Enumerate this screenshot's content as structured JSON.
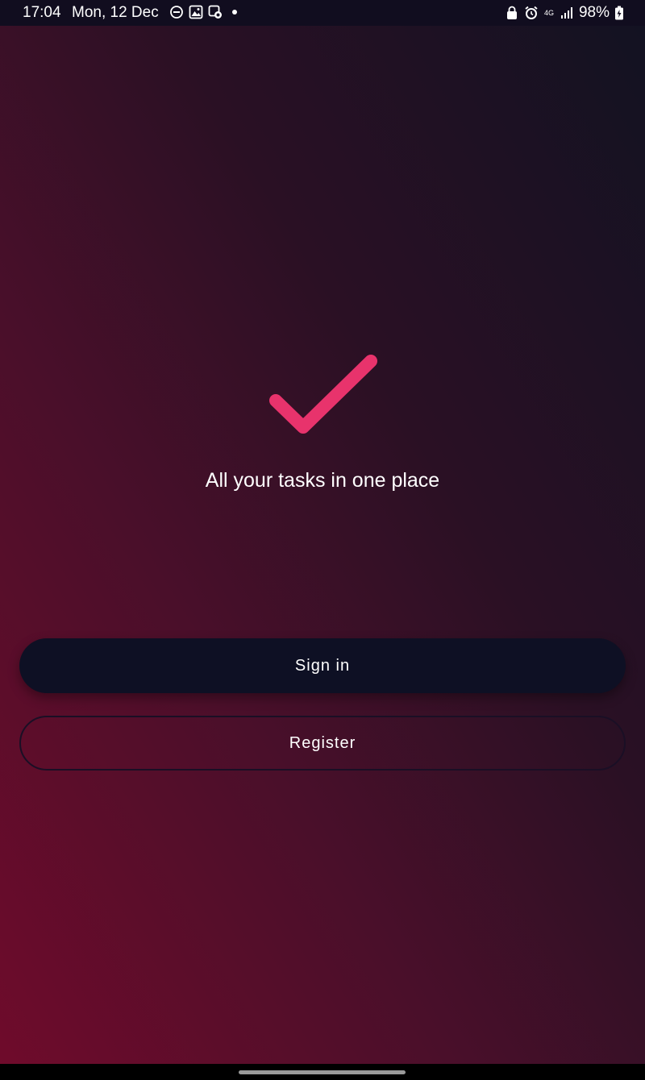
{
  "status_bar": {
    "time": "17:04",
    "date": "Mon, 12 Dec",
    "left_icons": [
      "do-not-disturb-icon",
      "gallery-icon",
      "screen-recorder-icon",
      "notification-dot-icon"
    ],
    "network": "4G",
    "battery": "98%"
  },
  "main": {
    "logo_icon": "checkmark-icon",
    "accent_color": "#e8336c",
    "tagline": "All your tasks in one place"
  },
  "actions": {
    "signin_label": "Sign in",
    "register_label": "Register"
  }
}
